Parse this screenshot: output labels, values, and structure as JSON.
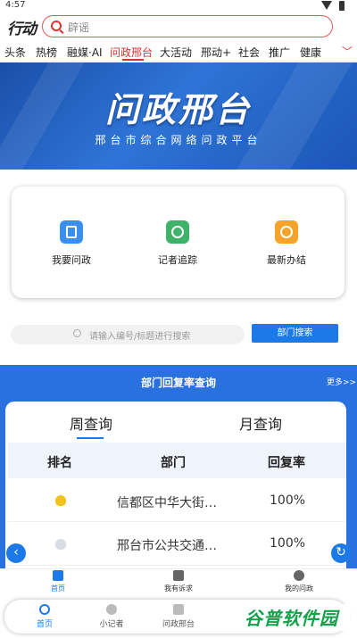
{
  "status": {
    "time": "4:57"
  },
  "header": {
    "logo": "行动",
    "search_placeholder": "辟谣"
  },
  "tabs": {
    "items": [
      "头条",
      "热榜",
      "融媒·AI",
      "问政邢台",
      "大活动",
      "邢动+",
      "社会",
      "推广",
      "健康"
    ],
    "active_index": 3,
    "more": "﹀"
  },
  "banner": {
    "title": "问政邢台",
    "subtitle": "邢台市综合网络问政平台"
  },
  "services": [
    {
      "label": "我要问政",
      "icon": "clipboard-icon",
      "color": "#3a8ef0"
    },
    {
      "label": "记者追踪",
      "icon": "reporter-icon",
      "color": "#3fb26a"
    },
    {
      "label": "最新办结",
      "icon": "clock-icon",
      "color": "#f5a32a"
    }
  ],
  "query": {
    "placeholder": "请输入编号/标题进行搜索",
    "button": "部门搜索"
  },
  "reply_rate": {
    "title": "部门回复率查询",
    "more": "更多>>",
    "tabs": [
      "周查询",
      "月查询"
    ],
    "active_tab": 0,
    "columns": [
      "排名",
      "部门",
      "回复率"
    ],
    "rows": [
      {
        "rank_icon": "gold-trophy-icon",
        "dept": "信都区中华大街…",
        "rate": "100%"
      },
      {
        "rank_icon": "silver-trophy-icon",
        "dept": "邢台市公共交通…",
        "rate": "100%"
      }
    ]
  },
  "inner_nav": [
    "首页",
    "我有诉求",
    "我的问政"
  ],
  "bottom_nav": [
    "首页",
    "小记者",
    "问政邢台"
  ],
  "watermark": "谷普软件园",
  "colors": {
    "accent_red": "#e0302f",
    "accent_blue": "#1b7ae8",
    "section_blue": "#2a71e0"
  }
}
